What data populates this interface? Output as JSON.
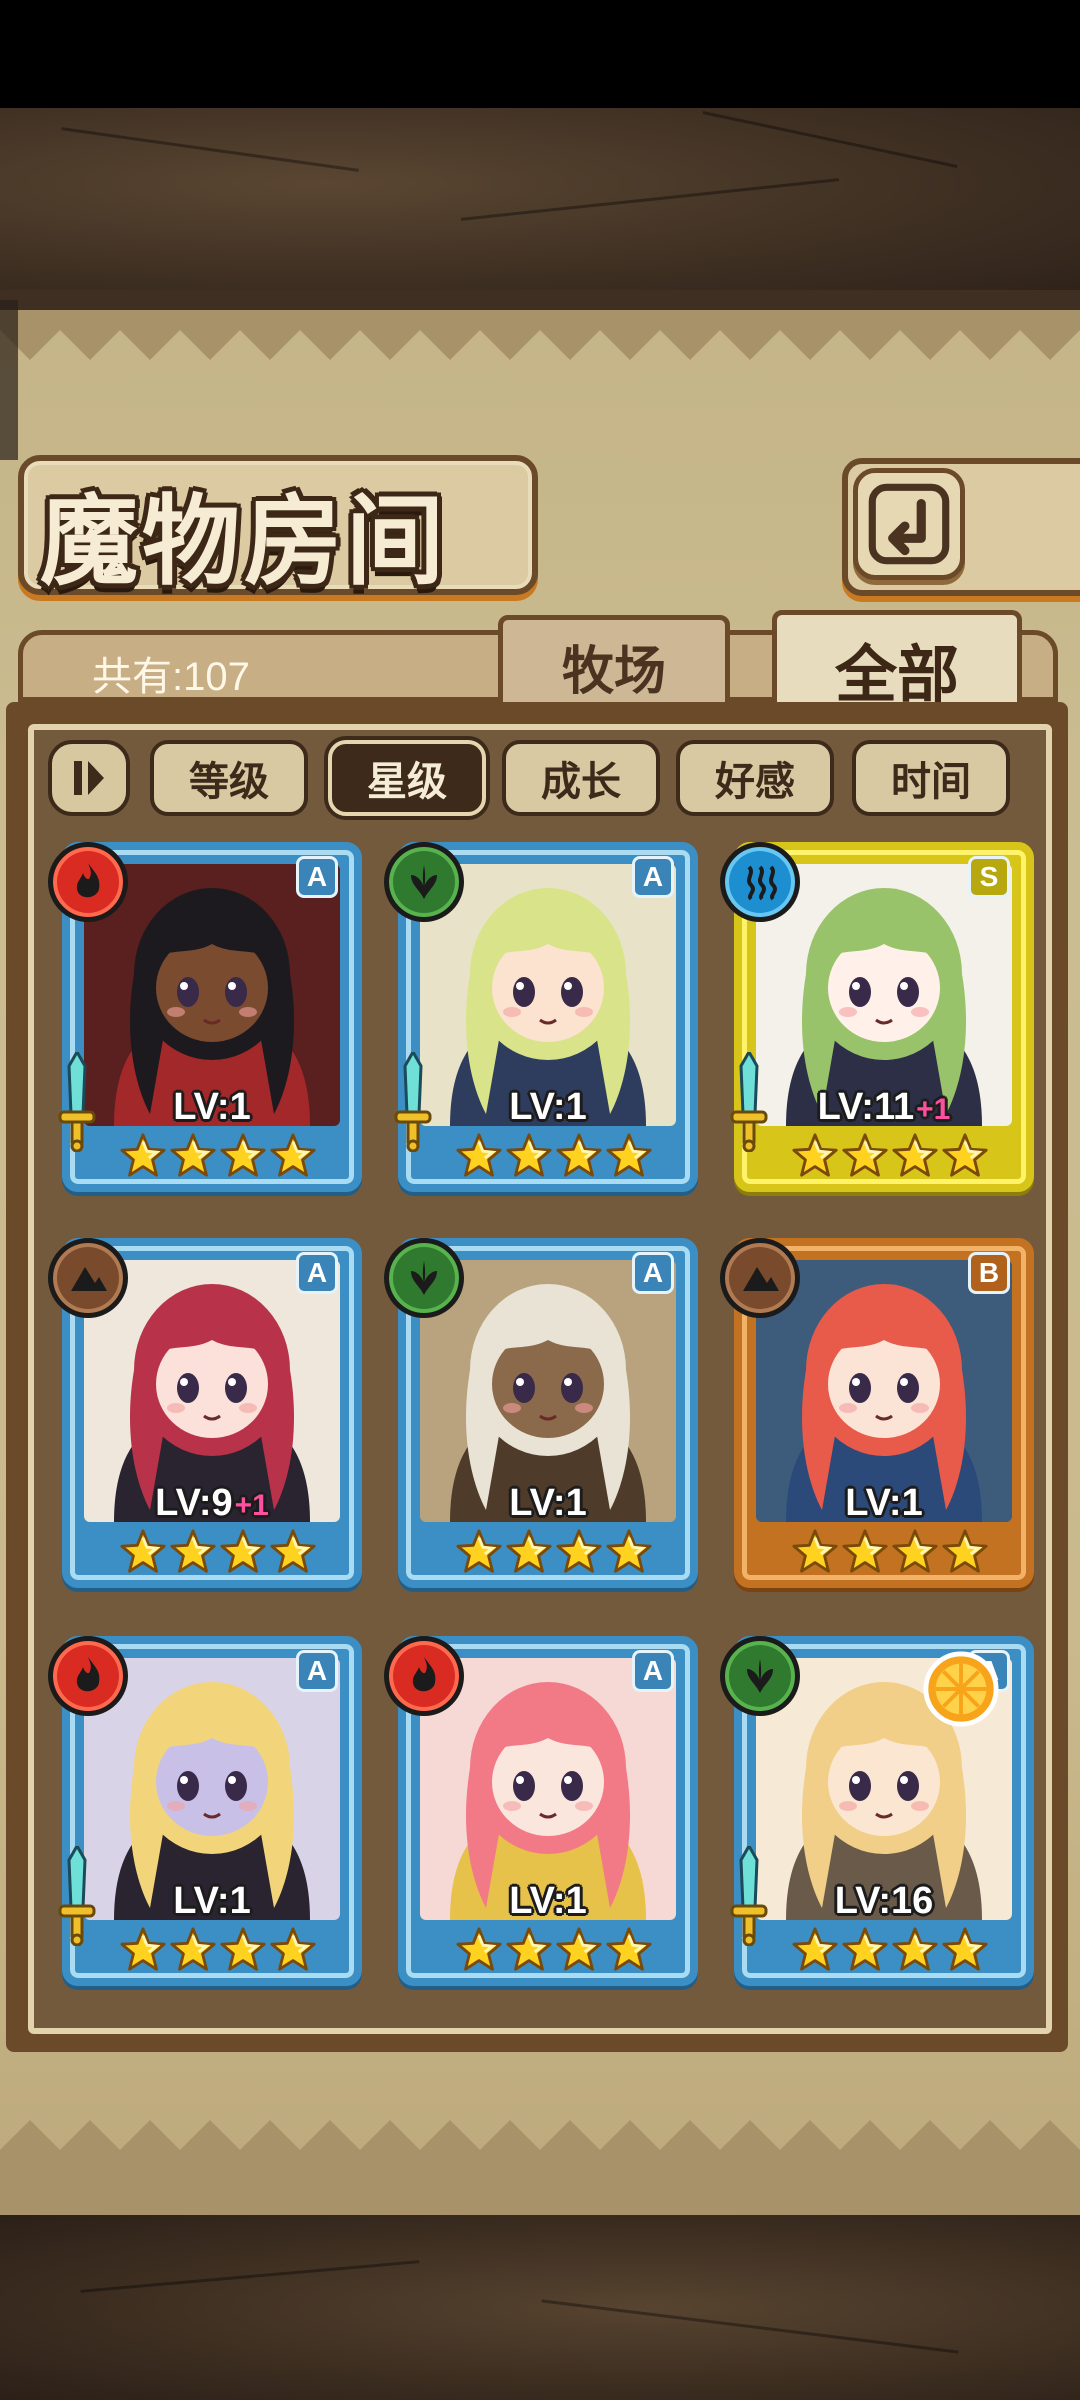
{
  "screen": {
    "title": "魔物房间",
    "total_count": "共有:107",
    "back_button_icon": "return-arrow-icon"
  },
  "tabs": [
    {
      "label": "牧场",
      "active": false
    },
    {
      "label": "全部",
      "active": true
    }
  ],
  "sort_buttons": [
    {
      "label": "等级",
      "active": false
    },
    {
      "label": "星级",
      "active": true
    },
    {
      "label": "成长",
      "active": false
    },
    {
      "label": "好感",
      "active": false
    },
    {
      "label": "时间",
      "active": false
    }
  ],
  "filter_toggle_icon": "filter-toggle-icon",
  "monsters": [
    {
      "element": "fire",
      "element_icon": "fire-icon",
      "rank": "A",
      "frame": "blue",
      "level": "LV:1",
      "bonus": "",
      "stars": 4,
      "weapon": "sword-icon",
      "hair": "#1d1a1f",
      "skin": "#7a4b2f",
      "accent": "#a3282a",
      "bg": "#5a1f1f"
    },
    {
      "element": "leaf",
      "element_icon": "leaf-icon",
      "rank": "A",
      "frame": "blue",
      "level": "LV:1",
      "bonus": "",
      "stars": 4,
      "weapon": "sword-icon",
      "hair": "#d9e38a",
      "skin": "#fbe3cf",
      "accent": "#2e3d5e",
      "bg": "#e8e3c8"
    },
    {
      "element": "water",
      "element_icon": "water-waves-icon",
      "rank": "S",
      "frame": "gold",
      "level": "LV:11",
      "bonus": "+1",
      "stars": 4,
      "weapon": "sword-icon",
      "hair": "#98c36a",
      "skin": "#fff1ea",
      "accent": "#2c2f45",
      "bg": "#f4f0ea"
    },
    {
      "element": "earth",
      "element_icon": "mountain-icon",
      "rank": "A",
      "frame": "blue",
      "level": "LV:9",
      "bonus": "+1",
      "stars": 4,
      "weapon": "",
      "hair": "#b8334a",
      "skin": "#fbe1d9",
      "accent": "#2a2430",
      "bg": "#efe6dc"
    },
    {
      "element": "leaf",
      "element_icon": "leaf-icon",
      "rank": "A",
      "frame": "blue",
      "level": "LV:1",
      "bonus": "",
      "stars": 4,
      "weapon": "",
      "hair": "#e9e3d6",
      "skin": "#8a6a4a",
      "accent": "#4e3b2a",
      "bg": "#b8a37e"
    },
    {
      "element": "earth",
      "element_icon": "mountain-icon",
      "rank": "B",
      "frame": "bronze",
      "level": "LV:1",
      "bonus": "",
      "stars": 4,
      "weapon": "",
      "hair": "#e85a4a",
      "skin": "#fbe3d6",
      "accent": "#2b4a7a",
      "bg": "#3d5b7a"
    },
    {
      "element": "fire",
      "element_icon": "fire-icon",
      "rank": "A",
      "frame": "blue",
      "level": "LV:1",
      "bonus": "",
      "stars": 4,
      "weapon": "sword-icon",
      "hair": "#f2d47a",
      "skin": "#c9c0e8",
      "accent": "#2a2430",
      "bg": "#d9d3e8"
    },
    {
      "element": "fire",
      "element_icon": "fire-icon",
      "rank": "A",
      "frame": "blue",
      "level": "LV:1",
      "bonus": "",
      "stars": 4,
      "weapon": "",
      "hair": "#f27a86",
      "skin": "#fbe6de",
      "accent": "#e6c24a",
      "bg": "#f6d9d4"
    },
    {
      "element": "leaf",
      "element_icon": "leaf-icon",
      "rank": "A",
      "frame": "blue",
      "level": "LV:16",
      "bonus": "",
      "stars": 4,
      "weapon": "sword-icon",
      "hair": "#f1cf88",
      "skin": "#fbe6d2",
      "accent": "#6a5a4a",
      "bg": "#f6ead6",
      "extra_icon": "orange-slice-icon"
    }
  ]
}
